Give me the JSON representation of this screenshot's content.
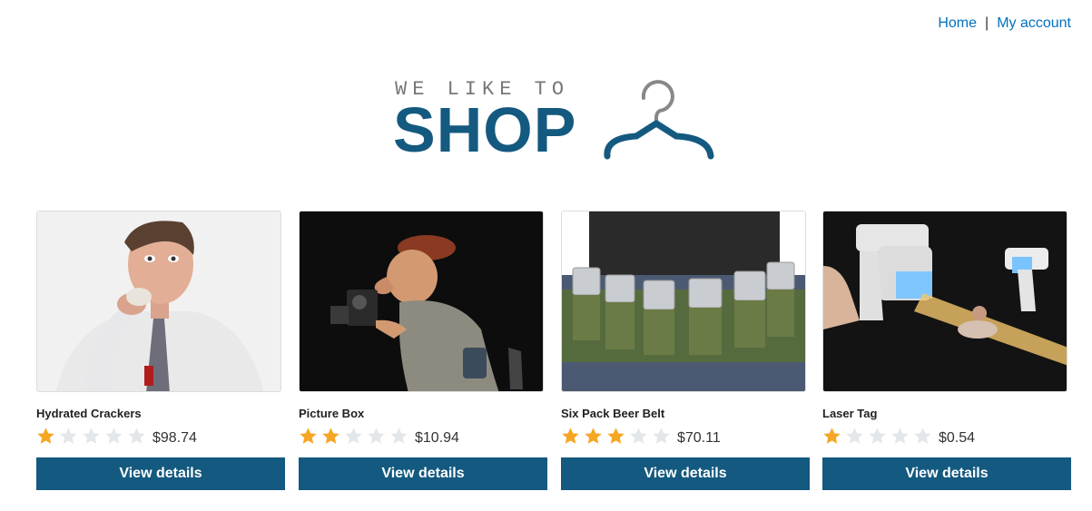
{
  "nav": {
    "home": "Home",
    "separator": "|",
    "account": "My account"
  },
  "logo": {
    "tagline": "WE LIKE TO",
    "word": "SHOP",
    "icon": "hanger-icon"
  },
  "colors": {
    "brand": "#14597f",
    "link": "#0071bc",
    "star_on": "#f5a623",
    "star_off": "#e4e7ea"
  },
  "products": [
    {
      "name": "Hydrated Crackers",
      "rating": 1,
      "max_rating": 5,
      "price": "$98.74",
      "button": "View details"
    },
    {
      "name": "Picture Box",
      "rating": 2,
      "max_rating": 5,
      "price": "$10.94",
      "button": "View details"
    },
    {
      "name": "Six Pack Beer Belt",
      "rating": 3,
      "max_rating": 5,
      "price": "$70.11",
      "button": "View details"
    },
    {
      "name": "Laser Tag",
      "rating": 1,
      "max_rating": 5,
      "price": "$0.54",
      "button": "View details"
    }
  ]
}
